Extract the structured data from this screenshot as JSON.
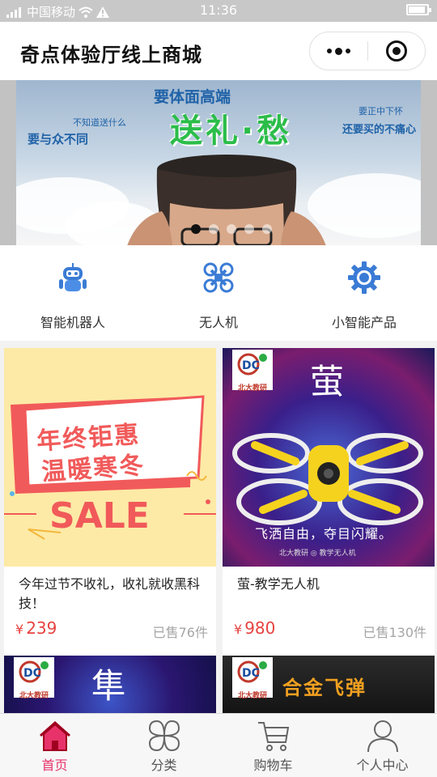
{
  "status_bar": {
    "carrier": "中国移动",
    "time": "11:36",
    "battery_level": 0.9
  },
  "nav": {
    "title": "奇点体验厅线上商城"
  },
  "banner": {
    "headline": "要体面高端",
    "main_text": "送礼·愁",
    "left_small": "不知道送什么",
    "left_text": "要与众不同",
    "right_small": "要正中下怀",
    "right_text": "还要买的不痛心",
    "slide_count": 5,
    "active_slide": 1
  },
  "categories": [
    {
      "label": "智能机器人",
      "icon": "robot-icon"
    },
    {
      "label": "无人机",
      "icon": "drone-icon"
    },
    {
      "label": "小智能产品",
      "icon": "gear-icon"
    }
  ],
  "products": [
    {
      "name": "今年过节不收礼，收礼就收黑科技！",
      "currency": "¥",
      "price": "239",
      "sold": "已售76件",
      "poster_line1": "年终钜惠",
      "poster_line2": "温暖寒冬",
      "poster_sale": "SALE"
    },
    {
      "name": "萤-教学无人机",
      "currency": "¥",
      "price": "980",
      "sold": "已售130件",
      "poster_title": "萤",
      "poster_slogan": "飞洒自由，夺目闪耀。",
      "poster_brand": "北大教研 ◎ 教学无人机",
      "logo_text": "北大教研"
    },
    {
      "poster_title": "隼",
      "logo_text": "北大教研"
    },
    {
      "poster_title": "合金飞弹",
      "logo_text": "北大教研"
    }
  ],
  "tabs": [
    {
      "label": "首页",
      "icon": "home-icon",
      "active": true
    },
    {
      "label": "分类",
      "icon": "category-icon",
      "active": false
    },
    {
      "label": "购物车",
      "icon": "cart-icon",
      "active": false
    },
    {
      "label": "个人中心",
      "icon": "user-icon",
      "active": false
    }
  ],
  "colors": {
    "accent": "#e7336a",
    "price": "#e64340",
    "category_icon": "#3a7bd5"
  }
}
